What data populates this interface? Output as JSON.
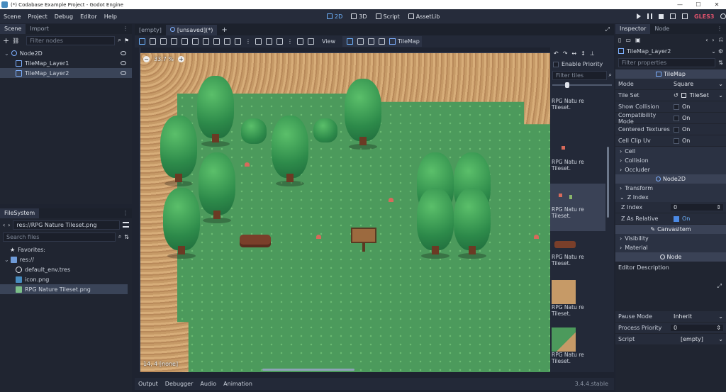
{
  "window": {
    "title": "(*) Codabase Example Project - Godot Engine",
    "controls": [
      "—",
      "☐",
      "✕"
    ]
  },
  "menu": [
    "Scene",
    "Project",
    "Debug",
    "Editor",
    "Help"
  ],
  "workspaces": {
    "w2d": "2D",
    "w3d": "3D",
    "script": "Script",
    "assetlib": "AssetLib"
  },
  "renderer": "GLES3",
  "scene_dock": {
    "tabs": [
      "Scene",
      "Import"
    ],
    "filter_placeholder": "Filter nodes",
    "nodes": [
      {
        "label": "Node2D"
      },
      {
        "label": "TileMap_Layer1"
      },
      {
        "label": "TileMap_Layer2"
      }
    ]
  },
  "filesystem": {
    "tab": "FileSystem",
    "path": "res://RPG Nature Tileset.png",
    "search_placeholder": "Search files",
    "favorites": "Favorites:",
    "root": "res://",
    "files": [
      "default_env.tres",
      "icon.png",
      "RPG Nature Tileset.png"
    ]
  },
  "editor": {
    "tabs": [
      "[empty]",
      "[unsaved](*)"
    ],
    "view_menu": "View",
    "tilemap_label": "TileMap",
    "zoom": "33.7 %",
    "coords": "14, 4 [none]"
  },
  "tile_panel": {
    "enable_priority": "Enable Priority",
    "filter_placeholder": "Filter tiles",
    "tiles": [
      "RPG Natu re Tileset.",
      "RPG Natu re Tileset.",
      "RPG Natu re Tileset.",
      "RPG Natu re Tileset.",
      "RPG Natu re Tileset.",
      "RPG Natu re Tileset."
    ]
  },
  "inspector": {
    "tabs": [
      "Inspector",
      "Node"
    ],
    "object_name": "TileMap_Layer2",
    "filter_placeholder": "Filter properties",
    "category_tilemap": "TileMap",
    "mode_label": "Mode",
    "mode_value": "Square",
    "tileset_label": "Tile Set",
    "tileset_value": "TileSet",
    "show_collision_label": "Show Collision",
    "show_collision_value": "On",
    "compat_label": "Compatibility Mode",
    "compat_value": "On",
    "centered_label": "Centered Textures",
    "centered_value": "On",
    "clip_label": "Cell Clip Uv",
    "clip_value": "On",
    "sections": [
      "Cell",
      "Collision",
      "Occluder"
    ],
    "category_node2d": "Node2D",
    "transform": "Transform",
    "zindex_section": "Z Index",
    "zindex_label": "Z Index",
    "zindex_value": "0",
    "zrel_label": "Z As Relative",
    "zrel_value": "On",
    "category_canvas": "CanvasItem",
    "visibility": "Visibility",
    "material": "Material",
    "category_node": "Node",
    "editor_desc": "Editor Description",
    "pause_label": "Pause Mode",
    "pause_value": "Inherit",
    "priority_label": "Process Priority",
    "priority_value": "0",
    "script_label": "Script",
    "script_value": "[empty]"
  },
  "bottom": {
    "tabs": [
      "Output",
      "Debugger",
      "Audio",
      "Animation"
    ],
    "version": "3.4.4.stable"
  },
  "colors": {
    "accent": "#6fb4ff",
    "grass": "#4c9a5c",
    "dirt": "#c69a67",
    "renderer": "#e0526c"
  }
}
